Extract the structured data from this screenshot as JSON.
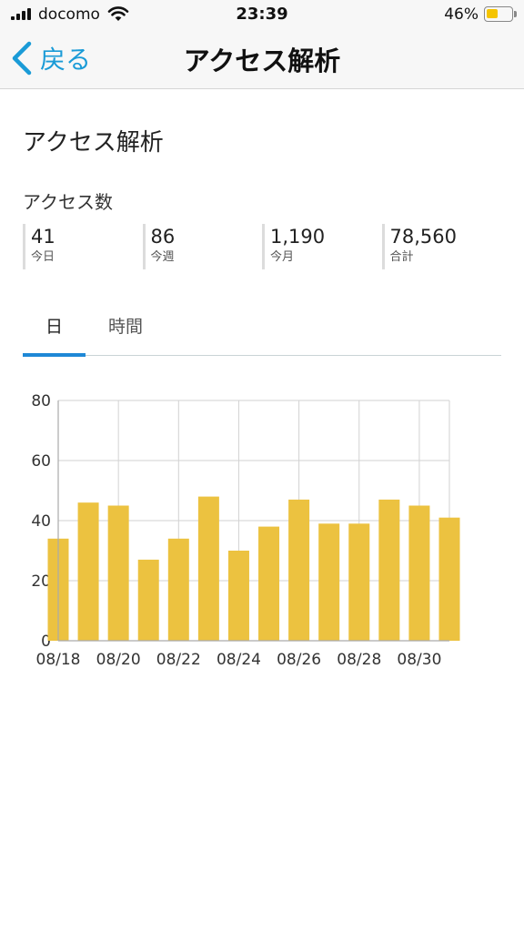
{
  "status_bar": {
    "carrier": "docomo",
    "time": "23:39",
    "battery_percent": "46%",
    "battery_level": 0.46,
    "battery_color": "#f5c400"
  },
  "nav": {
    "back_label": "戻る",
    "title": "アクセス解析",
    "accent_color": "#1a9bd7"
  },
  "page": {
    "heading": "アクセス解析",
    "section_label": "アクセス数",
    "stats": [
      {
        "value": "41",
        "label": "今日"
      },
      {
        "value": "86",
        "label": "今週"
      },
      {
        "value": "1,190",
        "label": "今月"
      },
      {
        "value": "78,560",
        "label": "合計"
      }
    ],
    "tabs": [
      {
        "label": "日",
        "active": true
      },
      {
        "label": "時間",
        "active": false
      }
    ]
  },
  "chart_data": {
    "type": "bar",
    "categories": [
      "08/18",
      "08/19",
      "08/20",
      "08/21",
      "08/22",
      "08/23",
      "08/24",
      "08/25",
      "08/26",
      "08/27",
      "08/28",
      "08/29",
      "08/30",
      "08/31"
    ],
    "x_tick_labels": [
      "08/18",
      "08/20",
      "08/22",
      "08/24",
      "08/26",
      "08/28",
      "08/30"
    ],
    "values": [
      34,
      46,
      45,
      27,
      34,
      48,
      30,
      38,
      47,
      39,
      39,
      47,
      45,
      41
    ],
    "y_ticks": [
      0,
      20,
      40,
      60,
      80
    ],
    "ylim": [
      0,
      80
    ],
    "bar_color": "#ecc240",
    "grid": true,
    "title": "",
    "xlabel": "",
    "ylabel": ""
  }
}
